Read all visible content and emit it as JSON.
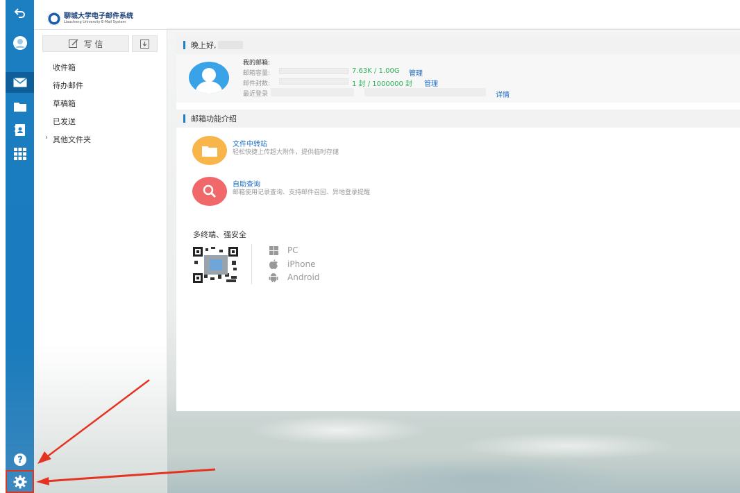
{
  "logo": {
    "title": "聊城大学电子邮件系统",
    "subtitle": "Liaocheng University E-Mail System"
  },
  "rail": {
    "icons": [
      "back-icon",
      "avatar-icon",
      "mail-icon",
      "folder-icon",
      "contacts-icon",
      "apps-icon",
      "help-icon",
      "settings-icon"
    ]
  },
  "folders": {
    "write_label": "写 信",
    "items": [
      "收件箱",
      "待办邮件",
      "草稿箱",
      "已发送"
    ],
    "other_label": "其他文件夹"
  },
  "greeting": {
    "title": "晚上好,"
  },
  "mailbox": {
    "heading": "我的邮箱:",
    "capacity_label": "邮箱容量:",
    "capacity_value": "7.63K / 1.00G",
    "capacity_fraction": 0.0,
    "capacity_manage": "管理",
    "count_label": "邮件封数:",
    "count_value": "1 封 / 1000000 封",
    "count_fraction": 0.0,
    "count_manage": "管理",
    "last_login_label": "最近登录",
    "details_link": "详情"
  },
  "intro": {
    "title": "邮箱功能介绍",
    "features": [
      {
        "icon": "folder-icon",
        "color": "#f7b54a",
        "title": "文件中转站",
        "desc": "轻松快捷上传超大附件，提供临时存储"
      },
      {
        "icon": "search-icon",
        "color": "#f0686a",
        "title": "自助查询",
        "desc": "邮箱使用记录查询、支持邮件召回、异地登录提醒"
      }
    ],
    "multi_title": "多终端、强安全",
    "platforms": [
      {
        "icon": "windows-icon",
        "label": "PC"
      },
      {
        "icon": "apple-icon",
        "label": "iPhone"
      },
      {
        "icon": "android-icon",
        "label": "Android"
      }
    ]
  },
  "colors": {
    "rail": "#1b7fc2",
    "accent": "#1b6ec2",
    "highlight": "#e53322",
    "green": "#2db45a"
  }
}
